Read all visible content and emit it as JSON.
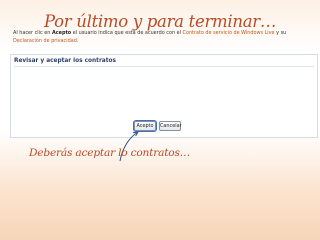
{
  "slide": {
    "title": "Por último y para terminar…",
    "caption": "Deberás aceptar lo contratos…"
  },
  "dialog": {
    "heading": "Revisar y aceptar los contratos",
    "text_1": "Al hacer clic en ",
    "text_bold": "Acepto",
    "text_2": " el usuario indica que está de acuerdo con el ",
    "link_1": "Contrato de servicio de Windows Live",
    "text_3": " y su",
    "link_2": "Declaración de privacidad",
    "text_4": ".",
    "accept_label": "Acepto",
    "cancel_label": "Cancelar"
  },
  "colors": {
    "title": "#b94a26",
    "link": "#c2561a",
    "heading": "#2b3f6a",
    "arrow": "#2f4f8f"
  }
}
